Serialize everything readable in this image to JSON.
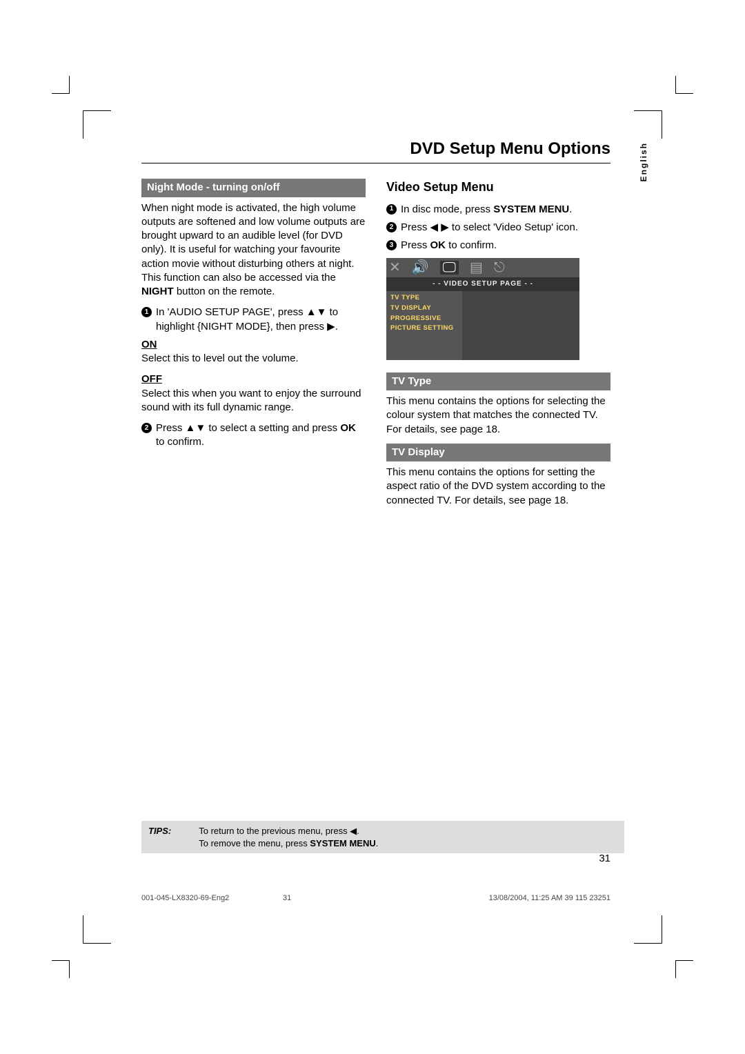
{
  "title": "DVD Setup Menu Options",
  "langTab": "English",
  "col1": {
    "header1": "Night Mode - turning on/off",
    "intro": "When night mode is activated, the high volume outputs are softened and low volume outputs are brought upward to an audible level (for DVD only).  It is useful for watching your favourite action movie without disturbing others at night. This function can also be accessed via the ",
    "introBold": "NIGHT",
    "introTail": " button on the remote.",
    "step1a": "In 'AUDIO SETUP PAGE', press ▲▼ to highlight {NIGHT MODE}, then press ▶.",
    "onLabel": "ON",
    "onText": "Select this to level out the volume.",
    "offLabel": "OFF",
    "offText": "Select this when you want to enjoy the surround sound with its full dynamic range.",
    "step2": "Press ▲▼ to select a setting and press ",
    "step2bold": "OK",
    "step2tail": " to confirm."
  },
  "col2": {
    "bigTitle": "Video Setup Menu",
    "step1a": "In disc mode, press ",
    "step1bold": "SYSTEM MENU",
    "step1tail": ".",
    "step2": "Press ◀ ▶ to select 'Video Setup' icon.",
    "step3a": "Press ",
    "step3bold": "OK",
    "step3tail": " to confirm.",
    "osdTitle": "- -   VIDEO  SETUP  PAGE   - -",
    "osdItems": [
      "TV TYPE",
      "TV DISPLAY",
      "PROGRESSIVE",
      "PICTURE SETTING"
    ],
    "header2": "TV Type",
    "text2": "This menu contains the options for selecting the colour system that matches the connected TV.  For details, see page 18.",
    "header3": "TV Display",
    "text3": "This menu contains the options for setting the aspect ratio of the DVD system according to the connected TV. For details, see page 18."
  },
  "tips": {
    "label": "TIPS:",
    "line1": "To return to the previous menu, press ◀.",
    "line2a": "To remove the menu, press ",
    "line2bold": "SYSTEM MENU",
    "line2tail": "."
  },
  "pageNumber": "31",
  "footer": {
    "left": "001-045-LX8320-69-Eng2",
    "mid": "31",
    "right": "13/08/2004, 11:25 AM 39 115 23251"
  }
}
